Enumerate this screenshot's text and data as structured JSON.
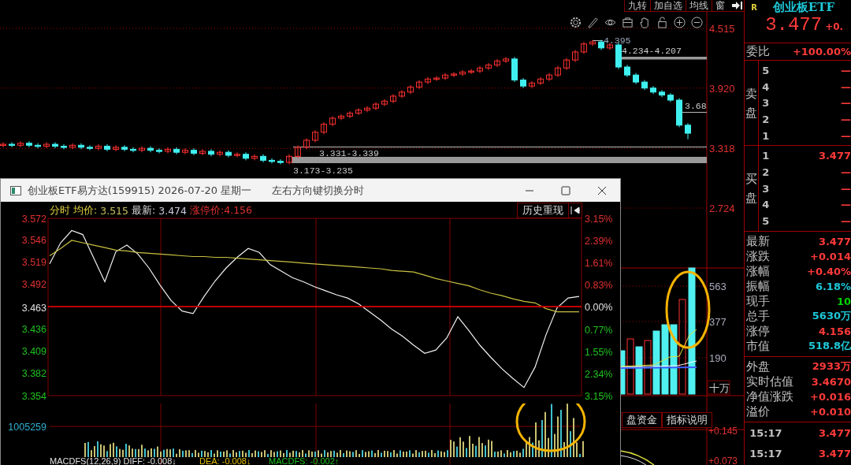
{
  "toolbar": {
    "buttons": [
      "九转",
      "加自选",
      "均线",
      "窗"
    ]
  },
  "main_chart": {
    "annotations": [
      "4.395",
      "4.234-4.207",
      "3.68",
      "3.331-3.339",
      "3.173-3.235"
    ],
    "chart_data": {
      "type": "candlestick",
      "ylim": [
        2.724,
        4.515
      ],
      "grid": true,
      "yticks": [
        {
          "value": 4.515,
          "label": "4.515"
        },
        {
          "value": 3.92,
          "label": "3.920"
        },
        {
          "value": 3.318,
          "label": "3.318"
        },
        {
          "value": 2.724,
          "label": "2.724"
        }
      ],
      "ohlc": [
        [
          3.35,
          3.38,
          3.33,
          3.36
        ],
        [
          3.36,
          3.38,
          3.33,
          3.35
        ],
        [
          3.35,
          3.39,
          3.33,
          3.37
        ],
        [
          3.37,
          3.39,
          3.33,
          3.35
        ],
        [
          3.35,
          3.37,
          3.32,
          3.34
        ],
        [
          3.34,
          3.38,
          3.32,
          3.36
        ],
        [
          3.36,
          3.38,
          3.32,
          3.34
        ],
        [
          3.34,
          3.36,
          3.31,
          3.33
        ],
        [
          3.33,
          3.37,
          3.31,
          3.35
        ],
        [
          3.35,
          3.37,
          3.31,
          3.33
        ],
        [
          3.33,
          3.35,
          3.3,
          3.32
        ],
        [
          3.32,
          3.36,
          3.3,
          3.34
        ],
        [
          3.34,
          3.36,
          3.29,
          3.31
        ],
        [
          3.31,
          3.35,
          3.29,
          3.33
        ],
        [
          3.33,
          3.35,
          3.29,
          3.31
        ],
        [
          3.31,
          3.33,
          3.28,
          3.3
        ],
        [
          3.3,
          3.34,
          3.28,
          3.32
        ],
        [
          3.32,
          3.34,
          3.28,
          3.3
        ],
        [
          3.3,
          3.32,
          3.27,
          3.29
        ],
        [
          3.29,
          3.33,
          3.27,
          3.31
        ],
        [
          3.31,
          3.33,
          3.26,
          3.28
        ],
        [
          3.28,
          3.32,
          3.26,
          3.3
        ],
        [
          3.3,
          3.32,
          3.25,
          3.27
        ],
        [
          3.27,
          3.31,
          3.25,
          3.29
        ],
        [
          3.29,
          3.31,
          3.24,
          3.26
        ],
        [
          3.26,
          3.3,
          3.24,
          3.28
        ],
        [
          3.28,
          3.3,
          3.23,
          3.25
        ],
        [
          3.25,
          3.28,
          3.23,
          3.26
        ],
        [
          3.26,
          3.28,
          3.2,
          3.22
        ],
        [
          3.22,
          3.26,
          3.2,
          3.24
        ],
        [
          3.24,
          3.26,
          3.18,
          3.2
        ],
        [
          3.2,
          3.22,
          3.17,
          3.19
        ],
        [
          3.19,
          3.21,
          3.16,
          3.18
        ],
        [
          3.18,
          3.26,
          3.16,
          3.24
        ],
        [
          3.24,
          3.35,
          3.22,
          3.33
        ],
        [
          3.33,
          3.42,
          3.31,
          3.4
        ],
        [
          3.4,
          3.5,
          3.38,
          3.48
        ],
        [
          3.48,
          3.58,
          3.46,
          3.56
        ],
        [
          3.56,
          3.64,
          3.54,
          3.62
        ],
        [
          3.62,
          3.66,
          3.6,
          3.64
        ],
        [
          3.64,
          3.69,
          3.62,
          3.67
        ],
        [
          3.67,
          3.72,
          3.65,
          3.7
        ],
        [
          3.7,
          3.74,
          3.68,
          3.72
        ],
        [
          3.72,
          3.78,
          3.7,
          3.76
        ],
        [
          3.76,
          3.81,
          3.74,
          3.79
        ],
        [
          3.79,
          3.86,
          3.77,
          3.84
        ],
        [
          3.84,
          3.9,
          3.82,
          3.88
        ],
        [
          3.88,
          3.95,
          3.86,
          3.93
        ],
        [
          3.93,
          4.0,
          3.91,
          3.98
        ],
        [
          3.98,
          4.03,
          3.96,
          4.01
        ],
        [
          4.01,
          4.04,
          3.99,
          4.02
        ],
        [
          4.02,
          4.07,
          4.0,
          4.05
        ],
        [
          4.05,
          4.08,
          4.03,
          4.06
        ],
        [
          4.06,
          4.1,
          4.04,
          4.08
        ],
        [
          4.08,
          4.11,
          4.06,
          4.09
        ],
        [
          4.09,
          4.14,
          4.07,
          4.12
        ],
        [
          4.12,
          4.17,
          4.1,
          4.15
        ],
        [
          4.15,
          4.21,
          4.13,
          4.19
        ],
        [
          4.19,
          4.23,
          4.17,
          4.21
        ],
        [
          4.21,
          4.23,
          3.98,
          4.0
        ],
        [
          4.0,
          4.02,
          3.92,
          3.94
        ],
        [
          3.94,
          3.99,
          3.92,
          3.97
        ],
        [
          3.97,
          4.03,
          3.95,
          4.01
        ],
        [
          4.01,
          4.07,
          3.99,
          4.05
        ],
        [
          4.05,
          4.14,
          4.03,
          4.12
        ],
        [
          4.12,
          4.22,
          4.1,
          4.2
        ],
        [
          4.2,
          4.3,
          4.18,
          4.28
        ],
        [
          4.28,
          4.38,
          4.26,
          4.36
        ],
        [
          4.36,
          4.4,
          4.34,
          4.38
        ],
        [
          4.38,
          4.4,
          4.3,
          4.32
        ],
        [
          4.32,
          4.37,
          4.3,
          4.35
        ],
        [
          4.35,
          4.37,
          4.11,
          4.13
        ],
        [
          4.13,
          4.15,
          4.03,
          4.05
        ],
        [
          4.05,
          4.07,
          3.96,
          3.98
        ],
        [
          3.98,
          4.0,
          3.9,
          3.92
        ],
        [
          3.92,
          3.94,
          3.86,
          3.88
        ],
        [
          3.88,
          3.9,
          3.83,
          3.85
        ],
        [
          3.85,
          3.87,
          3.78,
          3.8
        ],
        [
          3.8,
          3.82,
          3.53,
          3.55
        ],
        [
          3.55,
          3.57,
          3.41,
          3.47
        ]
      ]
    },
    "volume_labels": [
      "563",
      "377",
      "190"
    ],
    "volume_unit": "十万",
    "buttons": [
      "盘资金",
      "指标说明"
    ],
    "macd_labels": [
      "+0.145",
      "+0.073"
    ]
  },
  "popup": {
    "title": "创业板ETF易方达(159915) 2026-07-20 星期一",
    "hint": "左右方向键切换分时",
    "header": {
      "mode": "分时",
      "avg_label": "均价:",
      "avg": "3.515",
      "last_label": "最新:",
      "last": "3.474",
      "limit": "涨停价:4.156"
    },
    "history_button": "历史重现",
    "pct_ticks": [
      {
        "text": "3.15%",
        "color": "#e03030"
      },
      {
        "text": "2.39%",
        "color": "#e03030"
      },
      {
        "text": "1.61%",
        "color": "#e03030"
      },
      {
        "text": "0.83%",
        "color": "#e03030"
      },
      {
        "text": "0.00%",
        "color": "#e0e0e0"
      },
      {
        "text": "0.77%",
        "color": "#20c020"
      },
      {
        "text": "1.55%",
        "color": "#20c020"
      },
      {
        "text": "2.34%",
        "color": "#20c020"
      },
      {
        "text": "3.15%",
        "color": "#20c020"
      }
    ],
    "chart_data": {
      "type": "line",
      "ylim": [
        3.354,
        3.572
      ],
      "yticks": [
        {
          "value": 3.572,
          "label": "3.572"
        },
        {
          "value": 3.546,
          "label": "3.546"
        },
        {
          "value": 3.519,
          "label": "3.519"
        },
        {
          "value": 3.492,
          "label": "3.492"
        },
        {
          "value": 3.463,
          "label": "3.463"
        },
        {
          "value": 3.436,
          "label": "3.436"
        },
        {
          "value": 3.409,
          "label": "3.409"
        },
        {
          "value": 3.382,
          "label": "3.382"
        },
        {
          "value": 3.354,
          "label": "3.354"
        }
      ],
      "series": [
        {
          "color": "#f0f0f0",
          "values": [
            3.516,
            3.542,
            3.557,
            3.552,
            3.523,
            3.494,
            3.531,
            3.539,
            3.528,
            3.511,
            3.49,
            3.471,
            3.458,
            3.455,
            3.476,
            3.495,
            3.511,
            3.524,
            3.535,
            3.53,
            3.515,
            3.507,
            3.499,
            3.494,
            3.488,
            3.483,
            3.478,
            3.474,
            3.467,
            3.457,
            3.447,
            3.436,
            3.427,
            3.416,
            3.406,
            3.41,
            3.425,
            3.451,
            3.434,
            3.416,
            3.401,
            3.387,
            3.375,
            3.364,
            3.389,
            3.429,
            3.462,
            3.474,
            3.476
          ]
        },
        {
          "color": "#c8c040",
          "values": [
            3.526,
            3.535,
            3.545,
            3.542,
            3.539,
            3.536,
            3.533,
            3.532,
            3.53,
            3.529,
            3.528,
            3.527,
            3.526,
            3.525,
            3.525,
            3.524,
            3.524,
            3.523,
            3.522,
            3.521,
            3.52,
            3.519,
            3.518,
            3.517,
            3.516,
            3.515,
            3.514,
            3.513,
            3.512,
            3.511,
            3.51,
            3.508,
            3.507,
            3.506,
            3.502,
            3.498,
            3.495,
            3.492,
            3.489,
            3.484,
            3.48,
            3.477,
            3.473,
            3.47,
            3.468,
            3.461,
            3.457,
            3.457,
            3.457
          ]
        }
      ]
    },
    "volume_label": "1005259",
    "macd": [
      {
        "text": "MACDFS(12,26,9) DIFF: -0.008↓",
        "color": "#e0e0e0"
      },
      {
        "text": "DEA: -0.008↓",
        "color": "#e0c000"
      },
      {
        "text": "MACDFS: -0.002↑",
        "color": "#20c020"
      }
    ]
  },
  "quote": {
    "flag": "R",
    "name": "创业板ETF",
    "price": "3.477",
    "change": "+0.",
    "ratio_label": "委比",
    "ratio": "+100.00%",
    "sell_label": "卖盘",
    "sell": [
      {
        "rank": "5",
        "price": "—"
      },
      {
        "rank": "4",
        "price": "—"
      },
      {
        "rank": "3",
        "price": "—"
      },
      {
        "rank": "2",
        "price": "—"
      },
      {
        "rank": "1",
        "price": "—"
      }
    ],
    "buy_label": "买盘",
    "buy": [
      {
        "rank": "1",
        "price": "3.477"
      },
      {
        "rank": "2",
        "price": "—"
      },
      {
        "rank": "3",
        "price": "—"
      },
      {
        "rank": "4",
        "price": "—"
      },
      {
        "rank": "5",
        "price": "—"
      }
    ],
    "stats": [
      {
        "label": "最新",
        "value": "3.477",
        "color": "#ff3a3a"
      },
      {
        "label": "涨跌",
        "value": "+0.014",
        "color": "#ff3a3a"
      },
      {
        "label": "涨幅",
        "value": "+0.40%",
        "color": "#ff3a3a"
      },
      {
        "label": "振幅",
        "value": "6.18%",
        "color": "#1ec8d8"
      },
      {
        "label": "现手",
        "value": "10",
        "color": "#00d000"
      },
      {
        "label": "总手",
        "value": "5630万",
        "color": "#1ec8d8"
      },
      {
        "label": "涨停",
        "value": "4.156",
        "color": "#ff3a3a"
      },
      {
        "label": "市值",
        "value": "518.8亿",
        "color": "#1ec8d8"
      }
    ],
    "extra": [
      {
        "label": "外盘",
        "value": "2933万",
        "color": "#ff3a3a"
      },
      {
        "label": "实时估值",
        "value": "3.4670",
        "color": "#ff3a3a"
      },
      {
        "label": "净值涨跌",
        "value": "+0.016",
        "color": "#ff3a3a"
      },
      {
        "label": "溢价",
        "value": "+0.010",
        "color": "#ff3a3a"
      }
    ],
    "ticks": [
      {
        "time": "15:17",
        "price": "3.477"
      },
      {
        "time": "15:17",
        "price": "3.477"
      }
    ]
  }
}
